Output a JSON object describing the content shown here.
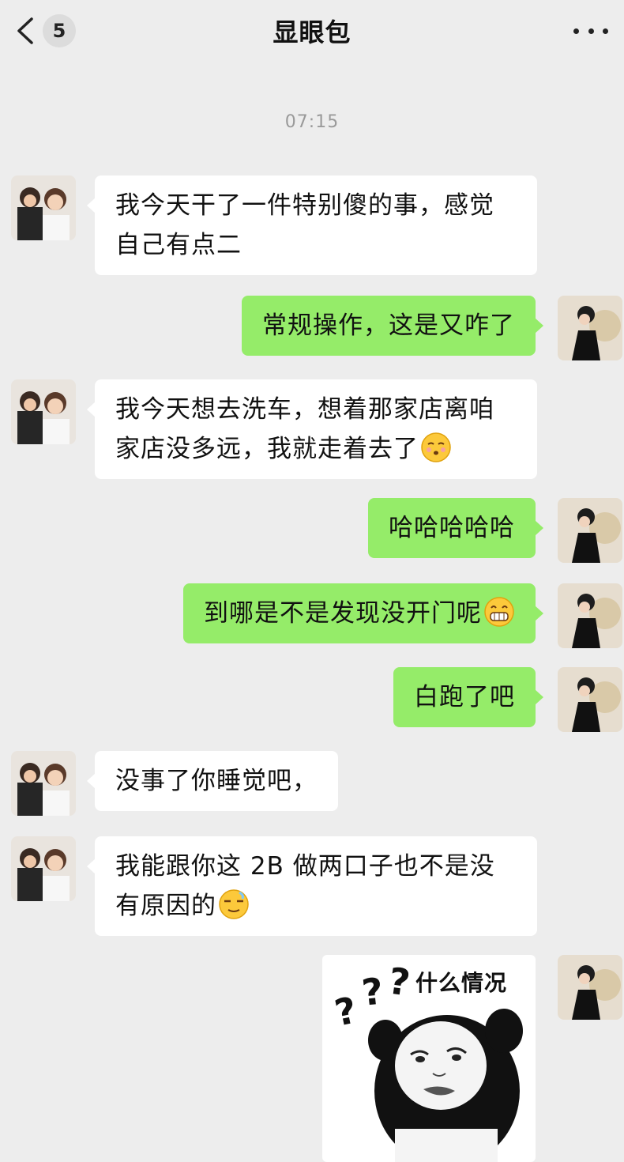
{
  "header": {
    "title": "显眼包",
    "unread_count": "5",
    "back_icon": "chevron-left-icon",
    "more_icon": "more-dots-icon"
  },
  "conversation": {
    "timestamp": "07:15",
    "messages": [
      {
        "side": "in",
        "text_lines": [
          "我今天干了一件特别傻的事，感觉",
          "自己有点二"
        ]
      },
      {
        "side": "out",
        "text": "常规操作，这是又咋了"
      },
      {
        "side": "in",
        "text_lines": [
          "我今天想去洗车，想着那家店离咱",
          "家店没多远，我就走着去了"
        ],
        "emoji": "hushed-face-emoji"
      },
      {
        "side": "out",
        "text": "哈哈哈哈哈"
      },
      {
        "side": "out",
        "text": "到哪是不是发现没开门呢",
        "emoji": "grinning-face-emoji"
      },
      {
        "side": "out",
        "text": "白跑了吧"
      },
      {
        "side": "in",
        "text": "没事了你睡觉吧，"
      },
      {
        "side": "in",
        "text_lines": [
          "我能跟你这 2B 做两口子也不是没",
          "有原因的"
        ],
        "emoji": "dizzy-face-emoji"
      },
      {
        "side": "out",
        "type": "sticker",
        "caption": "什么情况",
        "sticker_icon": "panda-meme-sticker"
      }
    ]
  },
  "colors": {
    "background": "#ededed",
    "outgoing_bubble": "#95ec69",
    "incoming_bubble": "#ffffff"
  }
}
